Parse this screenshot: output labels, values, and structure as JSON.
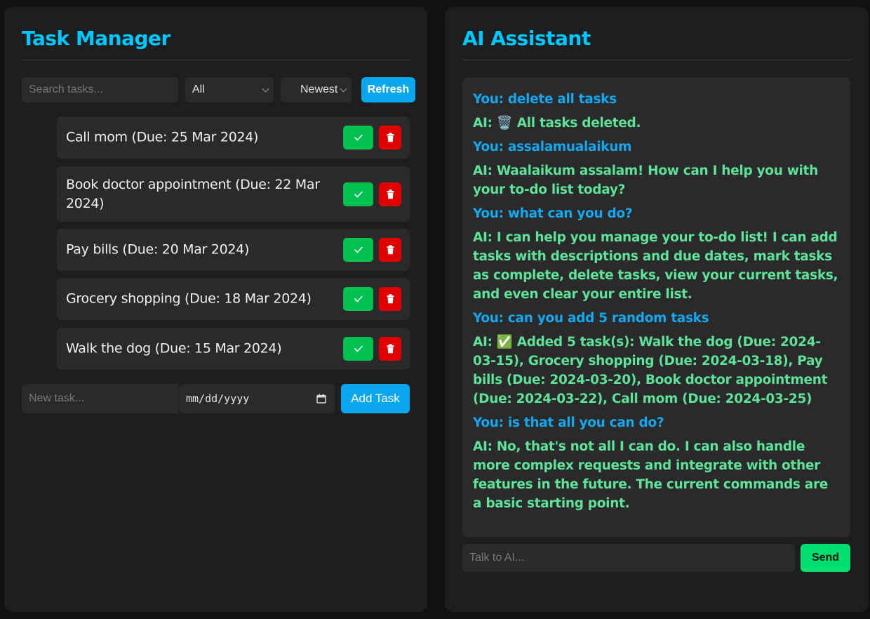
{
  "task_panel": {
    "title": "Task Manager",
    "search_placeholder": "Search tasks...",
    "filter_value": "All",
    "sort_value": "Newest",
    "refresh_label": "Refresh",
    "tasks": [
      {
        "label": "Call mom (Due: 25 Mar 2024)"
      },
      {
        "label": "Book doctor appointment (Due: 22 Mar 2024)"
      },
      {
        "label": "Pay bills (Due: 20 Mar 2024)"
      },
      {
        "label": "Grocery shopping (Due: 18 Mar 2024)"
      },
      {
        "label": "Walk the dog (Due: 15 Mar 2024)"
      }
    ],
    "new_task_placeholder": "New task...",
    "date_placeholder": "mm/dd/yyyy",
    "add_label": "Add Task"
  },
  "ai_panel": {
    "title": "AI Assistant",
    "messages": [
      {
        "role": "user",
        "text": "You: delete all tasks"
      },
      {
        "role": "ai",
        "text": "AI: 🗑️ All tasks deleted."
      },
      {
        "role": "user",
        "text": "You: assalamualaikum"
      },
      {
        "role": "ai",
        "text": "AI: Waalaikum assalam! How can I help you with your to-do list today?"
      },
      {
        "role": "user",
        "text": "You: what can you do?"
      },
      {
        "role": "ai",
        "text": "AI: I can help you manage your to-do list! I can add tasks with descriptions and due dates, mark tasks as complete, delete tasks, view your current tasks, and even clear your entire list."
      },
      {
        "role": "user",
        "text": "You: can you add 5 random tasks"
      },
      {
        "role": "ai",
        "text": "AI: ✅ Added 5 task(s): Walk the dog (Due: 2024-03-15), Grocery shopping (Due: 2024-03-18), Pay bills (Due: 2024-03-20), Book doctor appointment (Due: 2024-03-22), Call mom (Due: 2024-03-25)"
      },
      {
        "role": "user",
        "text": "You: is that all you can do?"
      },
      {
        "role": "ai",
        "text": "AI: No, that's not all I can do. I can also handle more complex requests and integrate with other features in the future. The current commands are a basic starting point."
      }
    ],
    "input_placeholder": "Talk to AI...",
    "send_label": "Send"
  },
  "colors": {
    "accent_title": "#00c8ff",
    "user_message": "#14a8f0",
    "ai_message": "#5ee29a",
    "complete_button": "#00c050",
    "delete_button": "#e00000",
    "send_button": "#00e070"
  },
  "icons": {
    "complete": "check-icon",
    "delete": "trash-icon",
    "calendar": "calendar-icon",
    "dropdown": "chevron-down-icon"
  }
}
